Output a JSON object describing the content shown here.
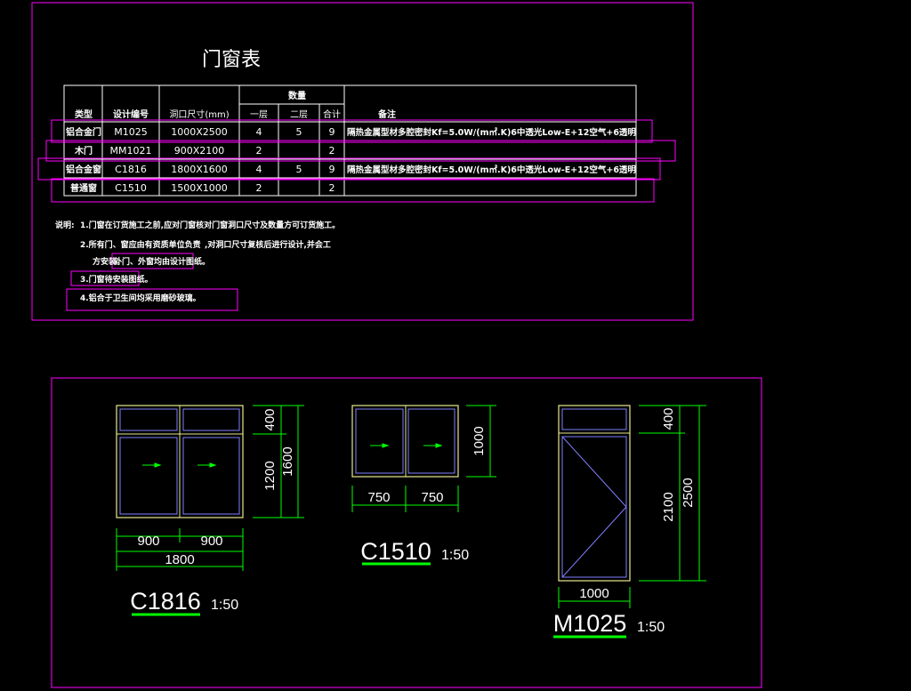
{
  "colors": {
    "magenta": "#ff00ff",
    "green": "#00ff00",
    "yellow": "#e8e890",
    "blue": "#8080ff",
    "white": "#ffffff"
  },
  "schedule": {
    "title": "门窗表",
    "headers": {
      "type": "类型",
      "code": "设计编号",
      "size": "洞口尺寸(mm)",
      "qty": "数量",
      "f1": "一层",
      "f2": "二层",
      "total": "合计",
      "note": "备注"
    },
    "rows": [
      {
        "type": "铝合金门",
        "code": "M1025",
        "size": "1000X2500",
        "f1": "4",
        "f2": "5",
        "total": "9",
        "note": "隔热金属型材多腔密封Kf=5.0W/(m㎡.K)6中透光Low-E+12空气+6透明"
      },
      {
        "type": "木门",
        "code": "MM1021",
        "size": "900X2100",
        "f1": "2",
        "f2": "",
        "total": "2",
        "note": ""
      },
      {
        "type": "铝合金窗",
        "code": "C1816",
        "size": "1800X1600",
        "f1": "4",
        "f2": "5",
        "total": "9",
        "note": "隔热金属型材多腔密封Kf=5.0W/(m㎡.K)6中透光Low-E+12空气+6透明"
      },
      {
        "type": "普通窗",
        "code": "C1510",
        "size": "1500X1000",
        "f1": "2",
        "f2": "",
        "total": "2",
        "note": ""
      }
    ]
  },
  "notes": {
    "label": "说明:",
    "n1": "1.门窗在订货施工之前,应对门窗核对门窗洞口尺寸及数量方可订货施工。",
    "n2a": "2.所有门、窗应由有资质单位负责",
    "n2b": ",对洞口尺寸复核后进行设计,并会工",
    "n2c": "方安装。",
    "n2d": "外门、外窗均由设计图纸。",
    "n3": "3.门窗待安装图纸。",
    "n4": "4.铝合于卫生间均采用磨砂玻璃。"
  },
  "elevations": {
    "c1816": {
      "label": "C1816",
      "scale": "1:50",
      "d_top": "400",
      "d_bottom": "1200",
      "d_total_h": "1600",
      "d_w1": "900",
      "d_w2": "900",
      "d_total_w": "1800"
    },
    "c1510": {
      "label": "C1510",
      "scale": "1:50",
      "d_h": "1000",
      "d_w1": "750",
      "d_w2": "750"
    },
    "m1025": {
      "label": "M1025",
      "scale": "1:50",
      "d_top": "400",
      "d_bottom": "2100",
      "d_total_h": "2500",
      "d_w": "1000"
    }
  }
}
